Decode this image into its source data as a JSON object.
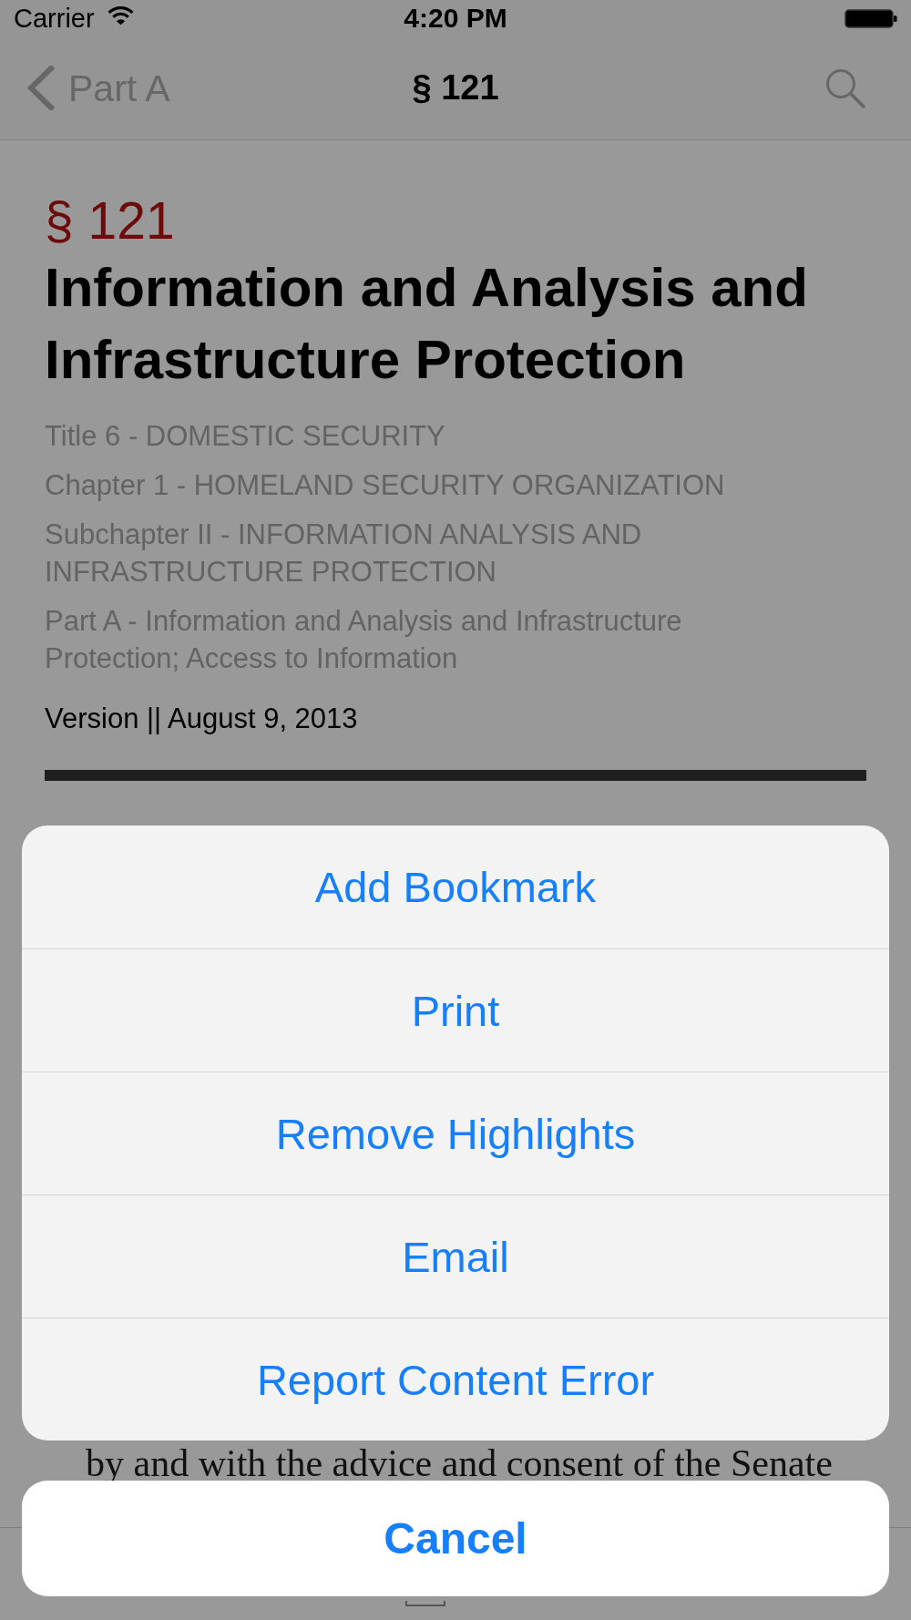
{
  "status_bar": {
    "carrier": "Carrier",
    "time": "4:20 PM"
  },
  "nav_bar": {
    "back_label": "Part A",
    "title": "§ 121"
  },
  "section": {
    "number": "§ 121",
    "heading": "Information and Analysis and Infrastructure Protection",
    "breadcrumbs": [
      "Title 6 - DOMESTIC SECURITY",
      "Chapter 1 - HOMELAND SECURITY ORGANIZATION",
      "Subchapter II - INFORMATION ANALYSIS AND INFRASTRUCTURE PROTECTION",
      "Part A - Information and Analysis and Infrastructure Protection; Access to Information"
    ],
    "version": "Version || August 9, 2013",
    "body_line": "by and with the advice and consent of the Senate"
  },
  "action_sheet": {
    "items": [
      {
        "label": "Add Bookmark"
      },
      {
        "label": "Print"
      },
      {
        "label": "Remove Highlights"
      },
      {
        "label": "Email"
      },
      {
        "label": "Report Content Error"
      }
    ],
    "cancel": "Cancel"
  }
}
